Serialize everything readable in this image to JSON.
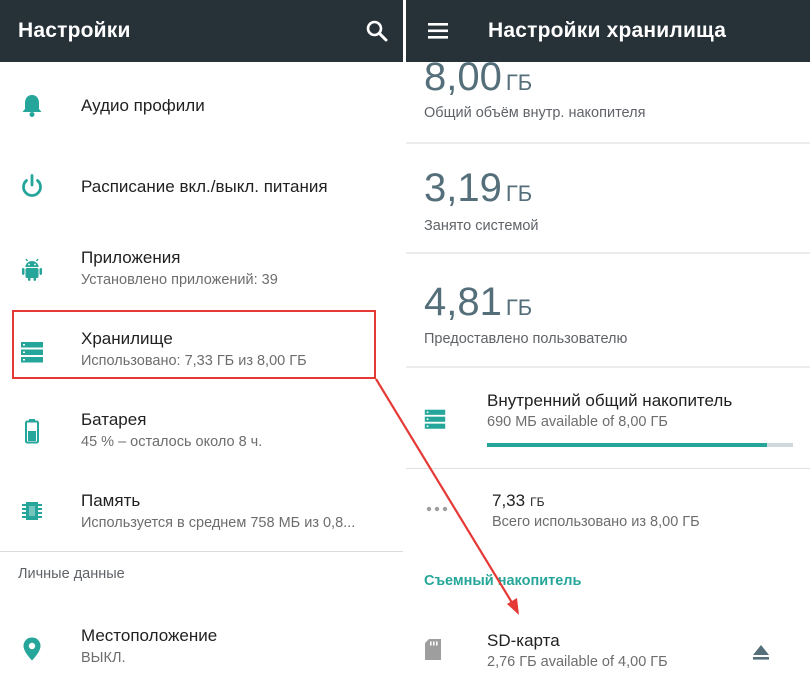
{
  "left": {
    "title": "Настройки",
    "items": [
      {
        "title": "Аудио профили",
        "sub": ""
      },
      {
        "title": "Расписание вкл./выкл. питания",
        "sub": ""
      },
      {
        "title": "Приложения",
        "sub": "Установлено приложений: 39"
      },
      {
        "title": "Хранилище",
        "sub": "Использовано: 7,33 ГБ из 8,00 ГБ"
      },
      {
        "title": "Батарея",
        "sub": "45 % – осталось около 8 ч."
      },
      {
        "title": "Память",
        "sub": "Используется в среднем 758 МБ из 0,8..."
      }
    ],
    "section_header": "Личные данные",
    "location": {
      "title": "Местоположение",
      "sub": "ВЫКЛ."
    }
  },
  "right": {
    "title": "Настройки хранилища",
    "total": {
      "value": "8,00",
      "unit": "ГБ",
      "label": "Общий объём внутр. накопителя"
    },
    "system": {
      "value": "3,19",
      "unit": "ГБ",
      "label": "Занято системой"
    },
    "user": {
      "value": "4,81",
      "unit": "ГБ",
      "label": "Предоставлено пользователю"
    },
    "internal": {
      "title": "Внутренний общий накопитель",
      "sub": "690 МБ available of 8,00 ГБ",
      "used_fraction": 0.914
    },
    "used": {
      "value": "7,33",
      "unit": "ГБ",
      "label": "Всего использовано из 8,00 ГБ"
    },
    "removable_header": "Съемный накопитель",
    "sd": {
      "title": "SD-карта",
      "sub": "2,76 ГБ available of 4,00 ГБ"
    }
  },
  "colors": {
    "appbar": "#263238",
    "accent": "#26a69a",
    "highlight": "#e53935",
    "value": "#546e7a"
  }
}
